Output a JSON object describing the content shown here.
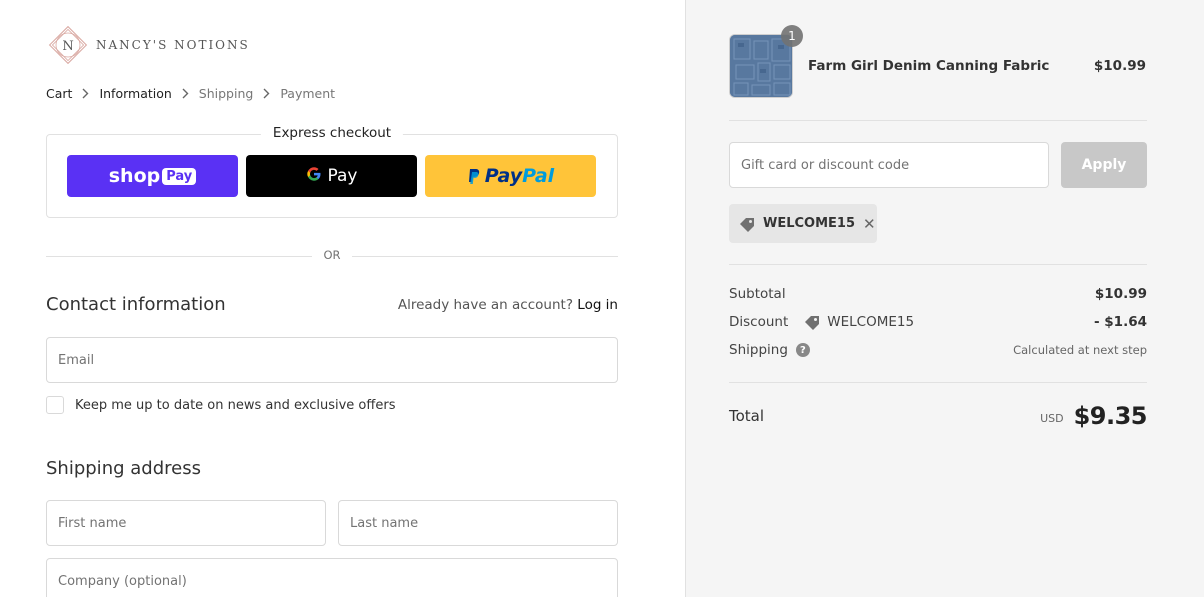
{
  "brand": {
    "logo_letter": "N",
    "name": "NANCY'S NOTIONS"
  },
  "breadcrumb": [
    {
      "label": "Cart"
    },
    {
      "label": "Information"
    },
    {
      "label": "Shipping"
    },
    {
      "label": "Payment"
    }
  ],
  "express": {
    "title": "Express checkout",
    "shop_pay": {
      "word": "shop",
      "pill": "Pay"
    },
    "google_pay": {
      "g": "G",
      "label": "Pay"
    },
    "paypal": {
      "pay": "Pay",
      "pal": "Pal"
    }
  },
  "or_label": "OR",
  "contact": {
    "title": "Contact information",
    "account_prompt": "Already have an account?",
    "login_link": "Log in",
    "email_placeholder": "Email",
    "newsletter_label": "Keep me up to date on news and exclusive offers"
  },
  "shipping_address": {
    "title": "Shipping address",
    "first_name_placeholder": "First name",
    "last_name_placeholder": "Last name",
    "company_placeholder": "Company (optional)"
  },
  "order": {
    "item": {
      "quantity": "1",
      "name": "Farm Girl Denim Canning Fabric",
      "price": "$10.99"
    },
    "discount_placeholder": "Gift card or discount code",
    "apply_label": "Apply",
    "applied_code": "WELCOME15",
    "subtotal_label": "Subtotal",
    "subtotal_value": "$10.99",
    "discount_label": "Discount",
    "discount_code": "WELCOME15",
    "discount_value": "- $1.64",
    "shipping_label": "Shipping",
    "shipping_note": "Calculated at next step",
    "total_label": "Total",
    "currency": "USD",
    "total_value": "$9.35"
  },
  "colors": {
    "shop_pay": "#5a31f4",
    "google_pay": "#000000",
    "paypal": "#ffc439",
    "apply_disabled": "#c8c8c8",
    "sidebar_bg": "#f5f5f5"
  }
}
